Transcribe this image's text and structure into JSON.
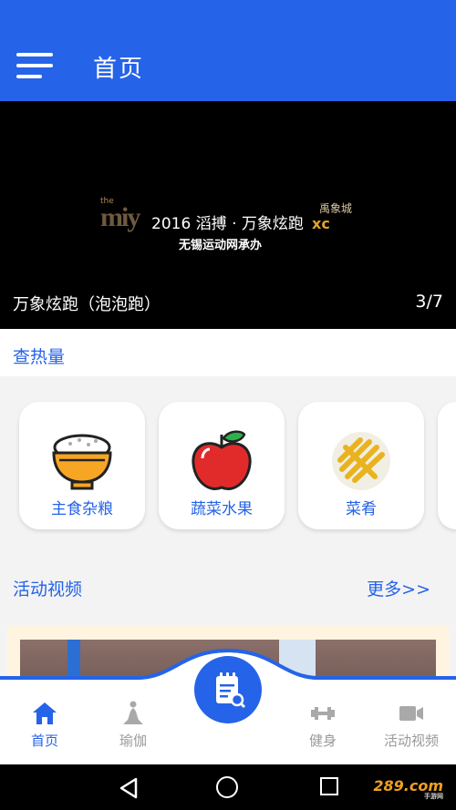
{
  "appbar": {
    "title": "首页",
    "menu_icon": "hamburger-menu-icon",
    "color": "#2563e8"
  },
  "banner": {
    "logo": {
      "the": "the",
      "my": "miy",
      "mainline": "2016 滔搏 · 万象炫跑",
      "subline": "无锡运动网承办",
      "brand": "禹象城",
      "mark": "xc"
    },
    "caption": "万象炫跑（泡泡跑）",
    "counter": "3/7"
  },
  "hot": {
    "title": "查热量",
    "cards": [
      {
        "label": "主食杂粮",
        "icon": "rice-bowl-icon"
      },
      {
        "label": "蔬菜水果",
        "icon": "apple-icon"
      },
      {
        "label": "菜肴",
        "icon": "fries-icon"
      }
    ]
  },
  "videos": {
    "title": "活动视频",
    "more": "更多>>"
  },
  "nav": {
    "items": [
      {
        "label": "首页",
        "icon": "home-icon",
        "active": true
      },
      {
        "label": "瑜伽",
        "icon": "yoga-icon",
        "active": false
      },
      {
        "label": "健身",
        "icon": "dumbbell-icon",
        "active": false
      },
      {
        "label": "活动视频",
        "icon": "video-camera-icon",
        "active": false
      }
    ],
    "fab_icon": "notepad-search-icon"
  },
  "system": {
    "watermark": "289.com",
    "watermark_sub": "手游网"
  }
}
